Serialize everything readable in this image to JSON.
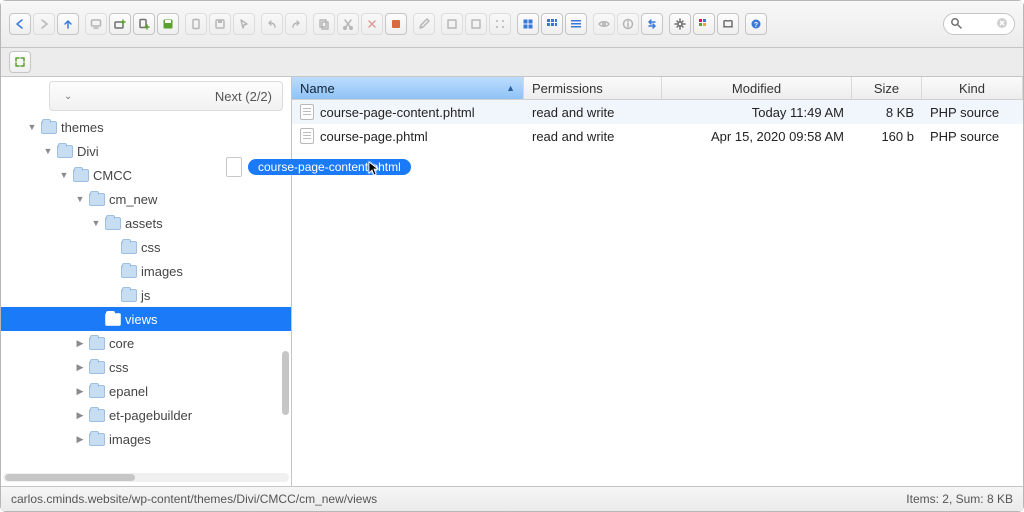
{
  "nav_label": "Next (2/2)",
  "tree": [
    {
      "indent": 0,
      "disclosure": "down",
      "label": "themes",
      "open": false,
      "selected": false
    },
    {
      "indent": 1,
      "disclosure": "down",
      "label": "Divi",
      "open": false,
      "selected": false
    },
    {
      "indent": 2,
      "disclosure": "down",
      "label": "CMCC",
      "open": false,
      "selected": false
    },
    {
      "indent": 3,
      "disclosure": "down",
      "label": "cm_new",
      "open": false,
      "selected": false
    },
    {
      "indent": 4,
      "disclosure": "down",
      "label": "assets",
      "open": false,
      "selected": false
    },
    {
      "indent": 5,
      "disclosure": "",
      "label": "css",
      "open": false,
      "selected": false
    },
    {
      "indent": 5,
      "disclosure": "",
      "label": "images",
      "open": false,
      "selected": false
    },
    {
      "indent": 5,
      "disclosure": "",
      "label": "js",
      "open": false,
      "selected": false
    },
    {
      "indent": 4,
      "disclosure": "",
      "label": "views",
      "open": true,
      "selected": true
    },
    {
      "indent": 3,
      "disclosure": "right",
      "label": "core",
      "open": false,
      "selected": false
    },
    {
      "indent": 3,
      "disclosure": "right",
      "label": "css",
      "open": false,
      "selected": false
    },
    {
      "indent": 3,
      "disclosure": "right",
      "label": "epanel",
      "open": false,
      "selected": false
    },
    {
      "indent": 3,
      "disclosure": "right",
      "label": "et-pagebuilder",
      "open": false,
      "selected": false
    },
    {
      "indent": 3,
      "disclosure": "right",
      "label": "images",
      "open": false,
      "selected": false
    }
  ],
  "columns": {
    "name": "Name",
    "permissions": "Permissions",
    "modified": "Modified",
    "size": "Size",
    "kind": "Kind"
  },
  "rows": [
    {
      "name": "course-page-content.phtml",
      "perm": "read and write",
      "mod": "Today 11:49 AM",
      "size": "8 KB",
      "kind": "PHP source"
    },
    {
      "name": "course-page.phtml",
      "perm": "read and write",
      "mod": "Apr 15, 2020 09:58 AM",
      "size": "160 b",
      "kind": "PHP source"
    }
  ],
  "drag_label": "course-page-content.phtml",
  "status_path": "carlos.cminds.website/wp-content/themes/Divi/CMCC/cm_new/views",
  "status_summary": "Items: 2, Sum: 8 KB"
}
